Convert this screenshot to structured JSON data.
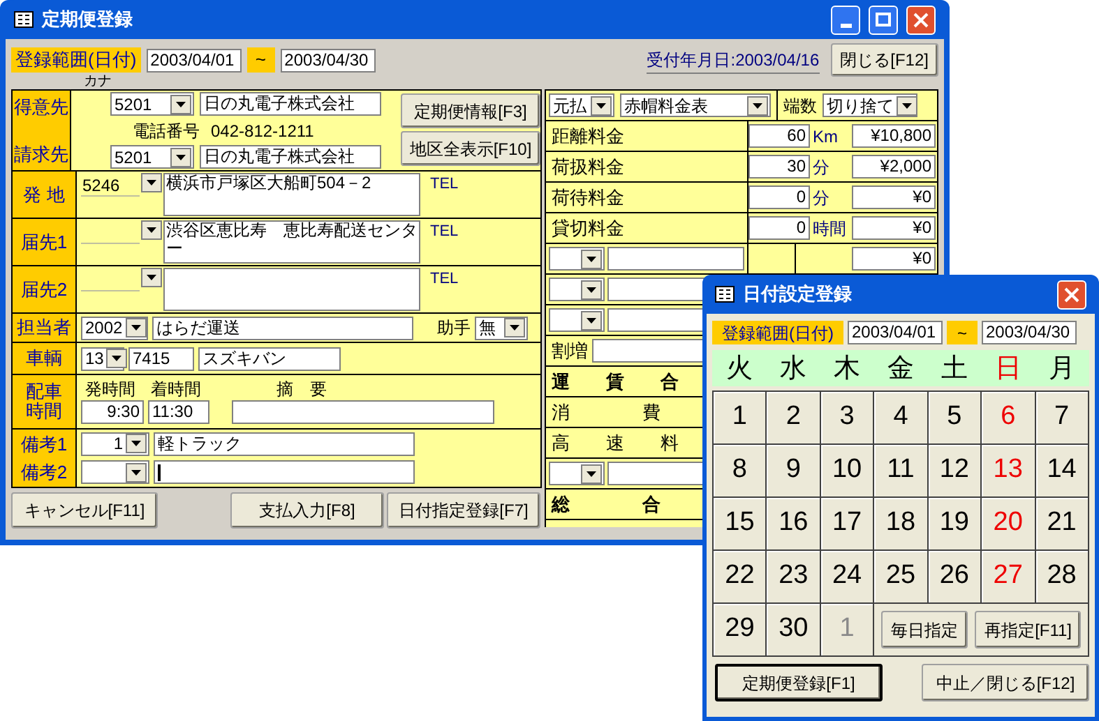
{
  "window": {
    "title": "定期便登録"
  },
  "range": {
    "label": "登録範囲(日付)",
    "from": "2003/04/01",
    "tilde": "~",
    "to": "2003/04/30"
  },
  "receipt": {
    "label": "受付年月日:",
    "date": "2003/04/16"
  },
  "close_button": "閉じる[F12]",
  "kana_label": "カナ",
  "customer": {
    "label": "得意先",
    "code": "5201",
    "name": "日の丸電子株式会社"
  },
  "phone": {
    "label": "電話番号",
    "value": "042-812-1211"
  },
  "billing": {
    "label": "請求先",
    "code": "5201",
    "name": "日の丸電子株式会社"
  },
  "side_buttons": [
    "定期便情報[F3]",
    "地区全表示[F10]"
  ],
  "addresses": [
    {
      "label": "発 地",
      "code": "5246",
      "text": "横浜市戸塚区大船町504－2",
      "tel_label": "TEL"
    },
    {
      "label": "届先1",
      "text": "渋谷区恵比寿　恵比寿配送センター",
      "tel_label": "TEL"
    },
    {
      "label": "届先2",
      "tel_label": "TEL"
    }
  ],
  "staff": {
    "label": "担当者",
    "code": "2002",
    "name": "はらだ運送",
    "assistant_label": "助手",
    "assistant": "無"
  },
  "vehicle": {
    "label": "車輌",
    "code": "13",
    "number": "7415",
    "name": "スズキバン"
  },
  "schedule": {
    "label": "配車時間",
    "depart_label": "発時間",
    "arrive_label": "着時間",
    "memo_label": "摘　要",
    "depart": "9:30",
    "arrive": "11:30"
  },
  "remarks": [
    {
      "label": "備考1",
      "code": "1",
      "text": "軽トラック",
      "cursor": false
    },
    {
      "label": "備考2",
      "cursor": true
    }
  ],
  "bottom_buttons": [
    "キャンセル[F11]",
    "支払入力[F8]",
    "日付指定登録[F7]"
  ],
  "fees": {
    "payment": "元払",
    "table": "赤帽料金表",
    "rounding_label": "端数",
    "rounding": "切り捨て"
  },
  "fee_rows": [
    {
      "kind": "measured",
      "label": "距離料金",
      "qty": "60",
      "unit": "Km",
      "amount": "¥10,800"
    },
    {
      "kind": "measured",
      "label": "荷扱料金",
      "qty": "30",
      "unit": "分",
      "amount": "¥2,000"
    },
    {
      "kind": "measured",
      "label": "荷待料金",
      "qty": "0",
      "unit": "分",
      "amount": "¥0"
    },
    {
      "kind": "measured",
      "label": "貸切料金",
      "qty": "0",
      "unit": "時間",
      "amount": "¥0"
    },
    {
      "kind": "select",
      "amount": "¥0"
    },
    {
      "kind": "select"
    },
    {
      "kind": "select"
    },
    {
      "kind": "surcharge",
      "label": "割増"
    },
    {
      "kind": "sum",
      "label": "運　　賃　　合"
    },
    {
      "kind": "line",
      "label": "消　　　　費"
    },
    {
      "kind": "line",
      "label": "高　　速　　料"
    },
    {
      "kind": "select"
    },
    {
      "kind": "sum",
      "label": "総　　　　合"
    }
  ],
  "dialog": {
    "title": "日付設定登録",
    "range": {
      "label": "登録範囲(日付)",
      "from": "2003/04/01",
      "tilde": "~",
      "to": "2003/04/30"
    },
    "weekdays": [
      {
        "label": "火",
        "holiday": false
      },
      {
        "label": "水",
        "holiday": false
      },
      {
        "label": "木",
        "holiday": false
      },
      {
        "label": "金",
        "holiday": false
      },
      {
        "label": "土",
        "holiday": false
      },
      {
        "label": "日",
        "holiday": true
      },
      {
        "label": "月",
        "holiday": false
      }
    ],
    "days": [
      {
        "label": "1",
        "holiday": false,
        "disabled": false
      },
      {
        "label": "2",
        "holiday": false,
        "disabled": false
      },
      {
        "label": "3",
        "holiday": false,
        "disabled": false
      },
      {
        "label": "4",
        "holiday": false,
        "disabled": false
      },
      {
        "label": "5",
        "holiday": false,
        "disabled": false
      },
      {
        "label": "6",
        "holiday": true,
        "disabled": false
      },
      {
        "label": "7",
        "holiday": false,
        "disabled": false
      },
      {
        "label": "8",
        "holiday": false,
        "disabled": false
      },
      {
        "label": "9",
        "holiday": false,
        "disabled": false
      },
      {
        "label": "10",
        "holiday": false,
        "disabled": false
      },
      {
        "label": "11",
        "holiday": false,
        "disabled": false
      },
      {
        "label": "12",
        "holiday": false,
        "disabled": false
      },
      {
        "label": "13",
        "holiday": true,
        "disabled": false
      },
      {
        "label": "14",
        "holiday": false,
        "disabled": false
      },
      {
        "label": "15",
        "holiday": false,
        "disabled": false
      },
      {
        "label": "16",
        "holiday": false,
        "disabled": false
      },
      {
        "label": "17",
        "holiday": false,
        "disabled": false
      },
      {
        "label": "18",
        "holiday": false,
        "disabled": false
      },
      {
        "label": "19",
        "holiday": false,
        "disabled": false
      },
      {
        "label": "20",
        "holiday": true,
        "disabled": false
      },
      {
        "label": "21",
        "holiday": false,
        "disabled": false
      },
      {
        "label": "22",
        "holiday": false,
        "disabled": false
      },
      {
        "label": "23",
        "holiday": false,
        "disabled": false
      },
      {
        "label": "24",
        "holiday": false,
        "disabled": false
      },
      {
        "label": "25",
        "holiday": false,
        "disabled": false
      },
      {
        "label": "26",
        "holiday": false,
        "disabled": false
      },
      {
        "label": "27",
        "holiday": true,
        "disabled": false
      },
      {
        "label": "28",
        "holiday": false,
        "disabled": false
      },
      {
        "label": "29",
        "holiday": false,
        "disabled": false
      },
      {
        "label": "30",
        "holiday": false,
        "disabled": false
      },
      {
        "label": "1",
        "holiday": false,
        "disabled": true
      }
    ],
    "daily_button": "毎日指定",
    "respecify_button": "再指定[F11]",
    "register_button": {
      "label": "定期便登録[F1]",
      "focused": true
    },
    "close_button": {
      "label": "中止／閉じる[F12]",
      "focused": false
    }
  }
}
